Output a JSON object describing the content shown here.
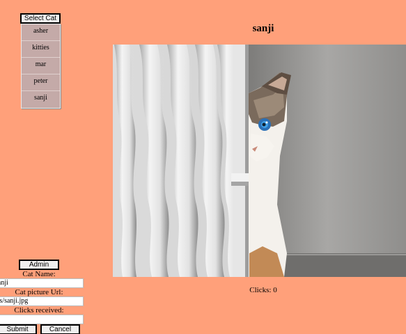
{
  "cat_selector": {
    "button_label": "Select Cat",
    "cats": [
      "asher",
      "kitties",
      "mar",
      "peter",
      "sanji"
    ]
  },
  "display": {
    "name": "sanji",
    "clicks_text": "Clicks: 0"
  },
  "admin": {
    "button_label": "Admin",
    "name_label": "Cat Name:",
    "name_value": "sanji",
    "url_label": "Cat picture Url:",
    "url_value": "images/sanji.jpg",
    "clicks_label": "Clicks received:",
    "clicks_value": "",
    "submit_label": "Submit",
    "cancel_label": "Cancel"
  },
  "colors": {
    "background": "#ffa07a",
    "list_background": "#c4aaa8"
  }
}
